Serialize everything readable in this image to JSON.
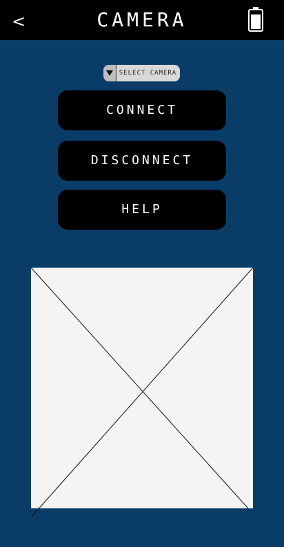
{
  "header": {
    "back_label": "<",
    "title": "CAMERA",
    "battery_icon": "battery-icon"
  },
  "camera_select": {
    "selected": "SELECT CAMERA",
    "arrow_icon": "triangle-down-icon"
  },
  "buttons": {
    "connect": "CONNECT",
    "disconnect": "DISCONNECT",
    "help": "HELP"
  },
  "image_placeholder": {
    "icon": "image-placeholder-icon"
  },
  "colors": {
    "background": "#0a3c68",
    "bar": "#000000",
    "button": "#000000",
    "placeholder": "#f3f4f3"
  }
}
